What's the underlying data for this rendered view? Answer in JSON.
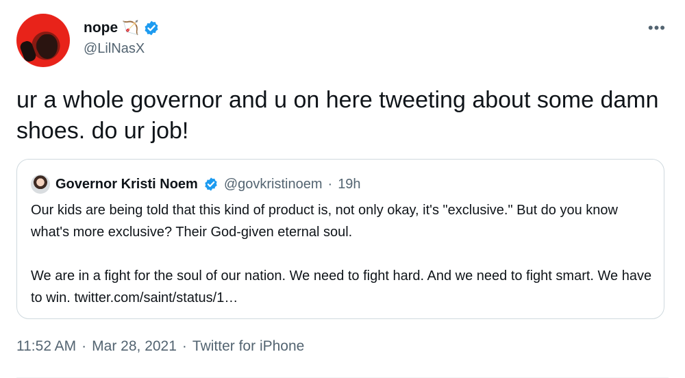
{
  "author": {
    "name": "nope",
    "emoji": "🏹",
    "handle": "@LilNasX",
    "verified": true
  },
  "menu": {
    "more_glyph": "•••"
  },
  "tweet_text": "ur a whole governor and u on here tweeting about some damn shoes. do ur job!",
  "quoted": {
    "name": "Governor Kristi Noem",
    "handle": "@govkristinoem",
    "separator": "·",
    "time": "19h",
    "paragraph1": "Our kids are being told that this kind of product is, not only okay, it's \"exclusive.\" But do you know what's more exclusive? Their God-given eternal soul.",
    "paragraph2": "We are in a fight for the soul of our nation. We need to fight hard. And we need to fight smart. We have to win. twitter.com/saint/status/1…"
  },
  "footer": {
    "time": "11:52 AM",
    "sep1": "·",
    "date": "Mar 28, 2021",
    "sep2": "·",
    "source": "Twitter for iPhone"
  },
  "colors": {
    "verified_blue": "#1d9bf0",
    "secondary_text": "#536471",
    "border": "#cfd9de"
  }
}
